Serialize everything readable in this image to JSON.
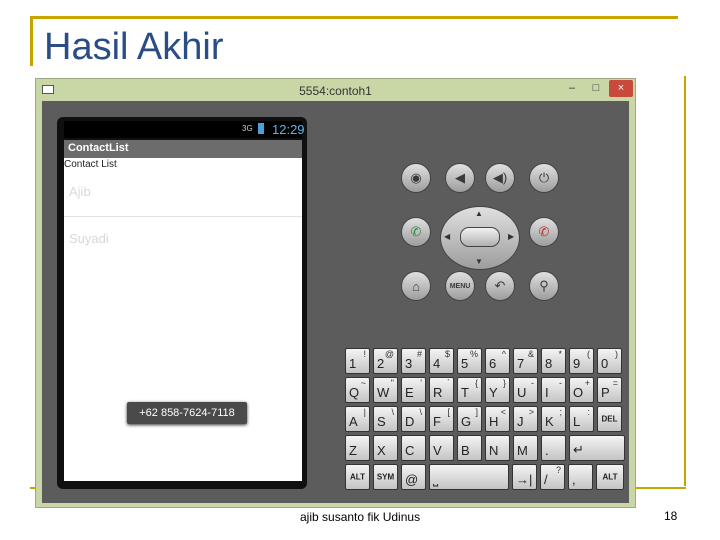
{
  "slide": {
    "title": "Hasil Akhir",
    "footer": "ajib susanto fik Udinus",
    "page_number": "18",
    "accent_color": "#c8a400",
    "title_color": "#2a4d86"
  },
  "window": {
    "title": "5554:contoh1",
    "minimize_label": "–",
    "maximize_label": "□",
    "close_label": "×"
  },
  "phone": {
    "status": {
      "clock": "12:29",
      "signal": "3G"
    },
    "action_bar_title": "ContactList",
    "list_header": "Contact List",
    "contacts": [
      {
        "name": "Ajib"
      },
      {
        "name": "Suyadi"
      }
    ],
    "toast": "+62 858-7624-7118"
  },
  "controls": {
    "camera_icon": "camera-icon",
    "volume_down_icon": "volume-down-icon",
    "volume_up_icon": "volume-up-icon",
    "power_icon": "power-icon",
    "call_icon": "call-icon",
    "end_call_icon": "end-call-icon",
    "home_icon": "home-icon",
    "back_icon": "back-icon",
    "search_icon": "search-icon",
    "menu_label": "MENU"
  },
  "keyboard": {
    "rows": [
      {
        "keys": [
          {
            "main": "1",
            "alt": "!"
          },
          {
            "main": "2",
            "alt": "@"
          },
          {
            "main": "3",
            "alt": "#"
          },
          {
            "main": "4",
            "alt": "$"
          },
          {
            "main": "5",
            "alt": "%"
          },
          {
            "main": "6",
            "alt": "^"
          },
          {
            "main": "7",
            "alt": "&"
          },
          {
            "main": "8",
            "alt": "*"
          },
          {
            "main": "9",
            "alt": "("
          },
          {
            "main": "0",
            "alt": ")"
          }
        ]
      },
      {
        "keys": [
          {
            "main": "Q",
            "alt": "~"
          },
          {
            "main": "W",
            "alt": "\""
          },
          {
            "main": "E",
            "alt": "'"
          },
          {
            "main": "R",
            "alt": "`"
          },
          {
            "main": "T",
            "alt": "{"
          },
          {
            "main": "Y",
            "alt": "}"
          },
          {
            "main": "U",
            "alt": "-"
          },
          {
            "main": "I",
            "alt": "-"
          },
          {
            "main": "O",
            "alt": "+"
          },
          {
            "main": "P",
            "alt": "="
          }
        ]
      },
      {
        "keys": [
          {
            "main": "A",
            "alt": "|"
          },
          {
            "main": "S",
            "alt": "\\"
          },
          {
            "main": "D",
            "alt": "\\"
          },
          {
            "main": "F",
            "alt": "["
          },
          {
            "main": "G",
            "alt": "]"
          },
          {
            "main": "H",
            "alt": "<"
          },
          {
            "main": "J",
            "alt": ">"
          },
          {
            "main": "K",
            "alt": ";"
          },
          {
            "main": "L",
            "alt": ":"
          },
          {
            "main": "DEL",
            "alt": ""
          }
        ]
      },
      {
        "keys": [
          {
            "main": "Z",
            "alt": ""
          },
          {
            "main": "X",
            "alt": ""
          },
          {
            "main": "C",
            "alt": ""
          },
          {
            "main": "V",
            "alt": ""
          },
          {
            "main": "B",
            "alt": ""
          },
          {
            "main": "N",
            "alt": ""
          },
          {
            "main": "M",
            "alt": ""
          },
          {
            "main": ".",
            "alt": ""
          },
          {
            "main": "↵",
            "alt": ""
          }
        ]
      },
      {
        "keys": [
          {
            "main": "ALT",
            "alt": ""
          },
          {
            "main": "SYM",
            "alt": ""
          },
          {
            "main": "@",
            "alt": ""
          },
          {
            "main": "⎵",
            "alt": ""
          },
          {
            "main": "→|",
            "alt": ""
          },
          {
            "main": "/",
            "alt": "?"
          },
          {
            "main": ",",
            "alt": ""
          },
          {
            "main": "ALT",
            "alt": ""
          }
        ]
      }
    ]
  }
}
